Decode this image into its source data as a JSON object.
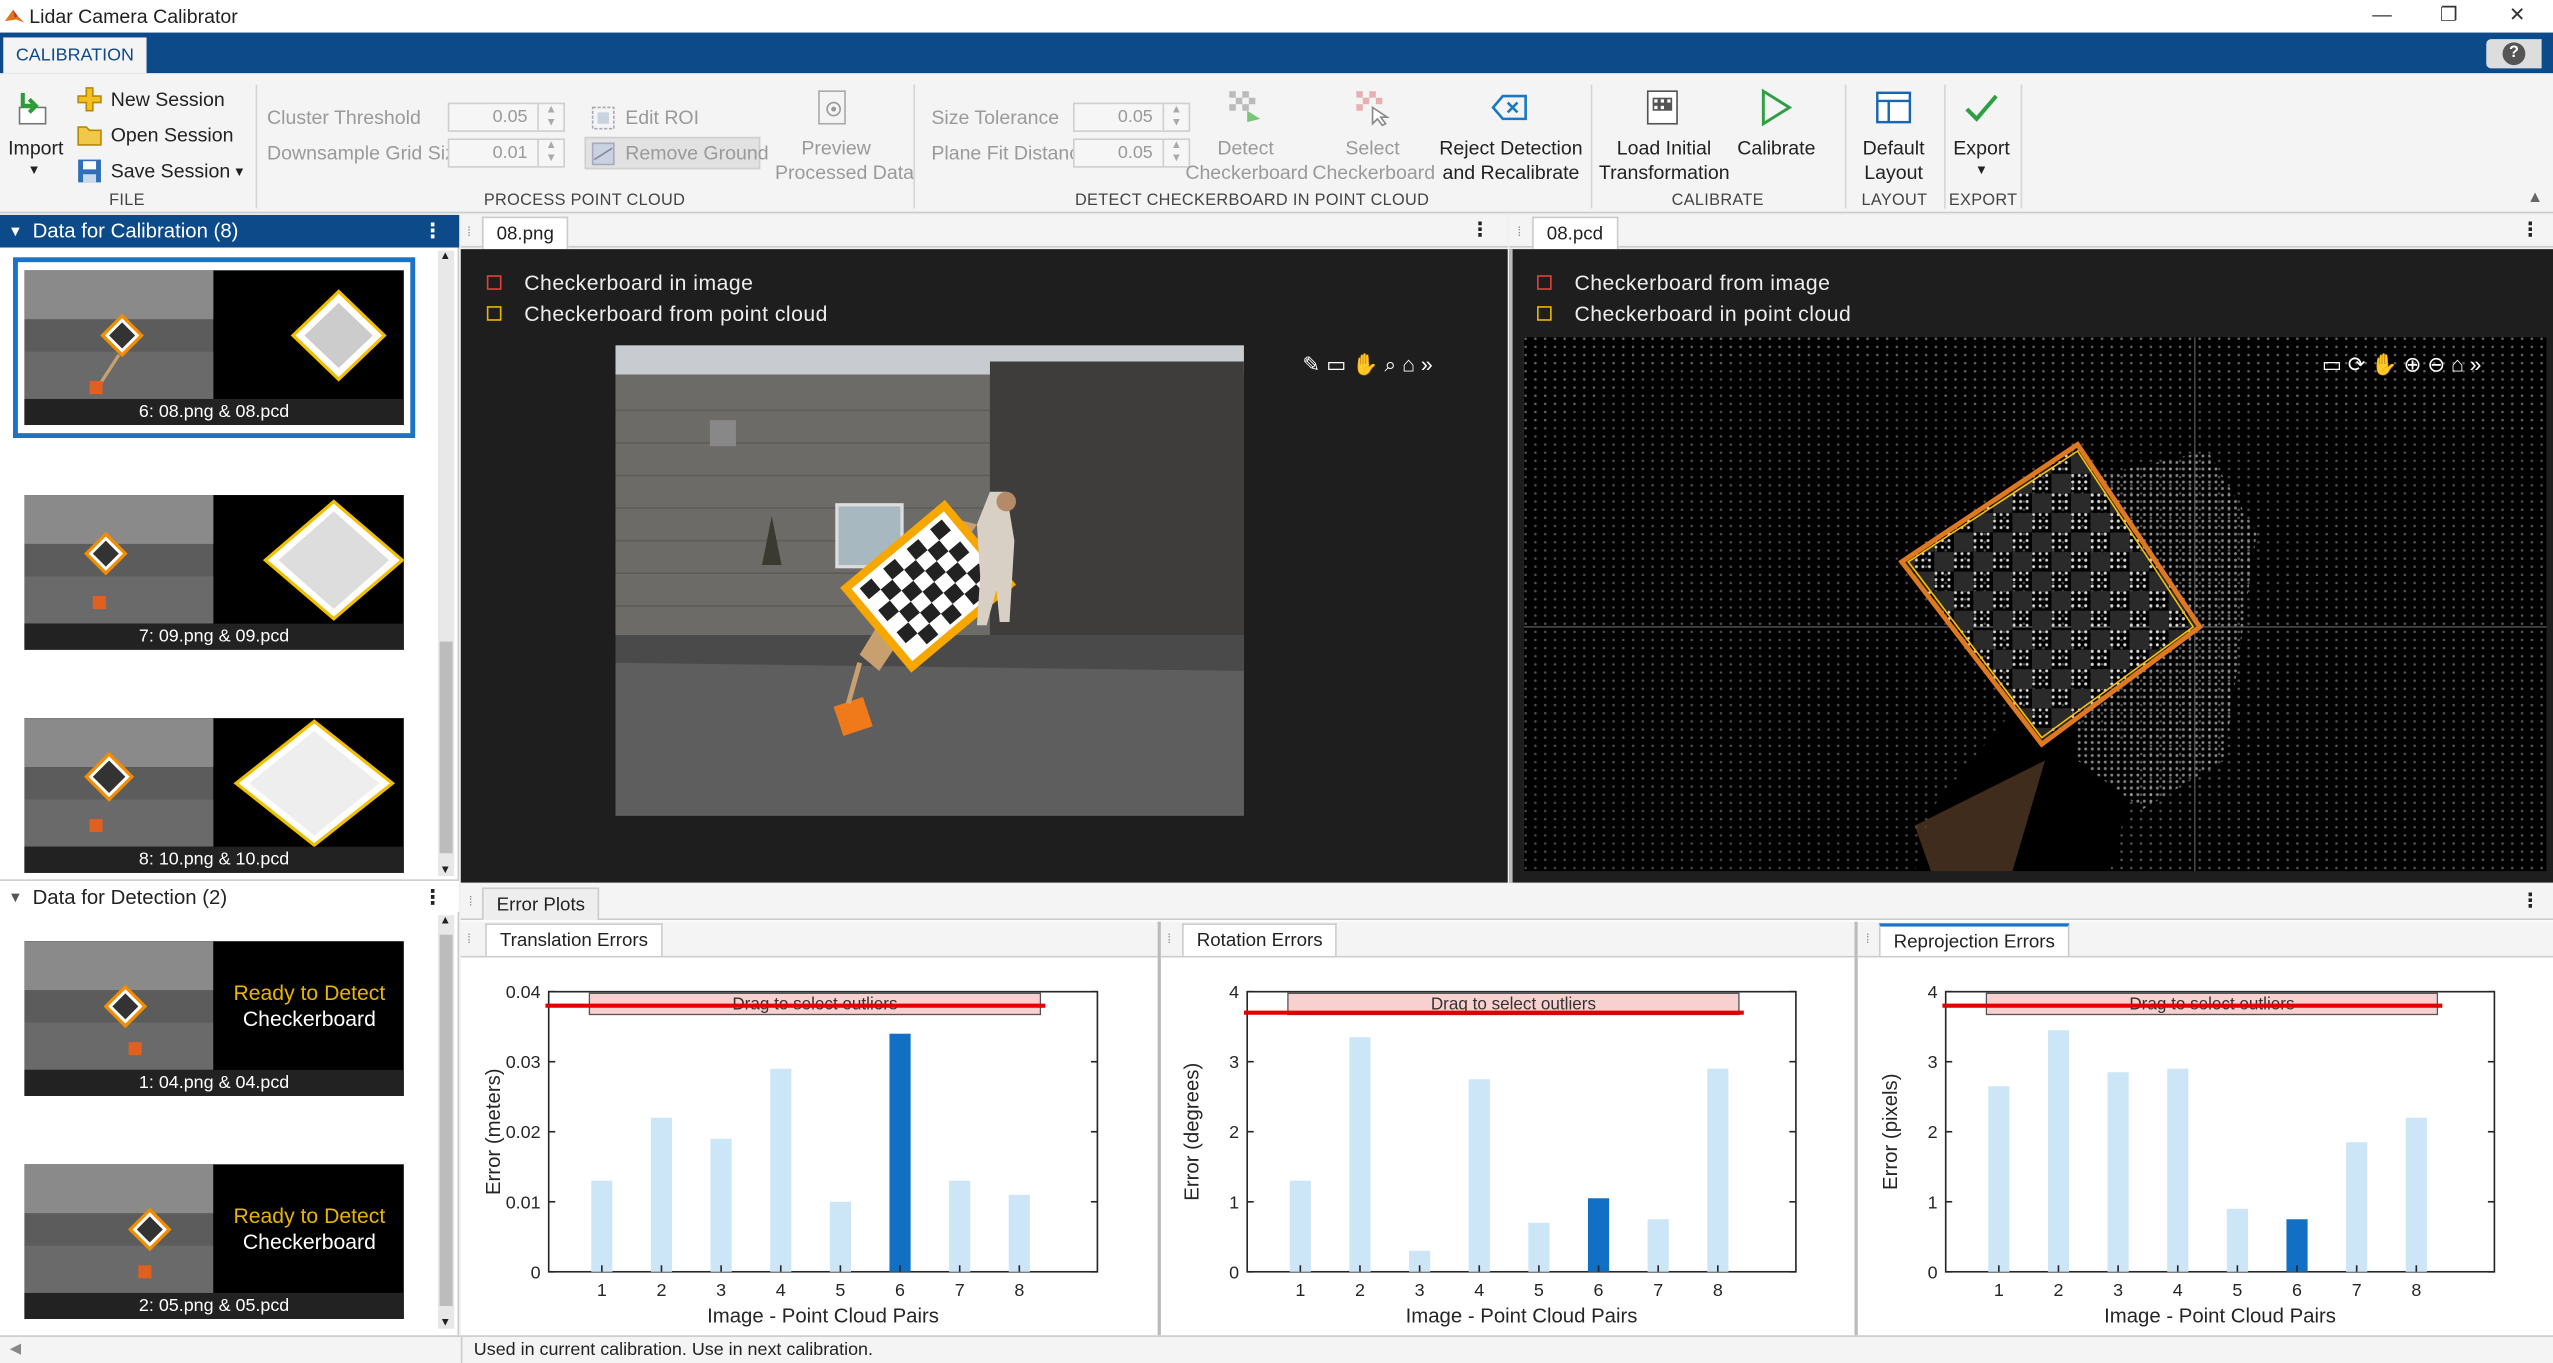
{
  "window": {
    "title": "Lidar Camera Calibrator",
    "minimize": "—",
    "restore": "❐",
    "close": "✕"
  },
  "tabs": [
    "CALIBRATION"
  ],
  "help_label": "?",
  "toolstrip": {
    "file": {
      "group_label": "FILE",
      "import_label": "Import",
      "new_session": "New Session",
      "open_session": "Open Session",
      "save_session": "Save Session"
    },
    "process": {
      "group_label": "PROCESS POINT CLOUD",
      "cluster_threshold_label": "Cluster Threshold",
      "cluster_threshold_value": "0.05",
      "downsample_label": "Downsample Grid Size",
      "downsample_value": "0.01",
      "edit_roi": "Edit ROI",
      "remove_ground": "Remove Ground",
      "preview_line1": "Preview",
      "preview_line2": "Processed Data"
    },
    "detect": {
      "group_label": "DETECT CHECKERBOARD IN POINT CLOUD",
      "size_tolerance_label": "Size Tolerance",
      "size_tolerance_value": "0.05",
      "plane_fit_label": "Plane Fit Distance",
      "plane_fit_value": "0.05",
      "detect_line1": "Detect",
      "detect_line2": "Checkerboard",
      "select_line1": "Select",
      "select_line2": "Checkerboard",
      "reject_line1": "Reject Detection",
      "reject_line2": "and Recalibrate"
    },
    "calibrate": {
      "group_label": "CALIBRATE",
      "load_line1": "Load Initial",
      "load_line2": "Transformation",
      "calibrate_label": "Calibrate"
    },
    "layout": {
      "group_label": "LAYOUT",
      "default_line1": "Default",
      "default_line2": "Layout"
    },
    "export": {
      "group_label": "EXPORT",
      "export_label": "Export"
    }
  },
  "left_panel": {
    "calibration_header": "Data for Calibration (8)",
    "calibration_items": [
      {
        "label": "6: 08.png & 08.pcd",
        "selected": true
      },
      {
        "label": "7: 09.png & 09.pcd",
        "selected": false
      },
      {
        "label": "8: 10.png & 10.pcd",
        "selected": false
      }
    ],
    "detection_header": "Data for Detection (2)",
    "detection_items": [
      {
        "label": "1: 04.png & 04.pcd",
        "status_line1": "Ready to Detect",
        "status_line2": "Checkerboard"
      },
      {
        "label": "2: 05.png & 05.pcd",
        "status_line1": "Ready to Detect",
        "status_line2": "Checkerboard"
      }
    ]
  },
  "image_pane": {
    "tab": "08.png",
    "legend": [
      "Checkerboard  in  image",
      "Checkerboard  from  point  cloud"
    ]
  },
  "pcd_pane": {
    "tab": "08.pcd",
    "legend": [
      "Checkerboard  from  image",
      "Checkerboard  in  point  cloud"
    ]
  },
  "colors": {
    "legend_red": "#e0403a",
    "legend_yellow": "#e8b400",
    "bar_light": "#cde6f7",
    "bar_selected": "#1170c4",
    "threshold_line": "#e00000",
    "drag_box": "#f9d0d0",
    "brand_blue": "#0c4a8a"
  },
  "error_panel": {
    "tab": "Error Plots",
    "subtabs": [
      "Translation Errors",
      "Rotation Errors",
      "Reprojection Errors"
    ]
  },
  "chart_data": [
    {
      "type": "bar",
      "title": "Translation Errors",
      "categories": [
        "1",
        "2",
        "3",
        "4",
        "5",
        "6",
        "7",
        "8"
      ],
      "values": [
        0.013,
        0.022,
        0.019,
        0.029,
        0.01,
        0.034,
        0.013,
        0.011
      ],
      "selected_index": 5,
      "threshold": 0.038,
      "ylim": [
        0,
        0.04
      ],
      "yticks": [
        "0",
        "0.01",
        "0.02",
        "0.03",
        "0.04"
      ],
      "xlabel": "Image - Point Cloud Pairs",
      "ylabel": "Error (meters)",
      "annotation": "Drag to select outliers"
    },
    {
      "type": "bar",
      "title": "Rotation Errors",
      "categories": [
        "1",
        "2",
        "3",
        "4",
        "5",
        "6",
        "7",
        "8"
      ],
      "values": [
        1.3,
        3.35,
        0.3,
        2.75,
        0.7,
        1.05,
        0.75,
        2.9
      ],
      "selected_index": 5,
      "threshold": 3.7,
      "ylim": [
        0,
        4
      ],
      "yticks": [
        "0",
        "1",
        "2",
        "3",
        "4"
      ],
      "xlabel": "Image - Point Cloud Pairs",
      "ylabel": "Error (degrees)",
      "annotation": "Drag to select outliers"
    },
    {
      "type": "bar",
      "title": "Reprojection Errors",
      "categories": [
        "1",
        "2",
        "3",
        "4",
        "5",
        "6",
        "7",
        "8"
      ],
      "values": [
        2.65,
        3.45,
        2.85,
        2.9,
        0.9,
        0.75,
        1.85,
        2.2
      ],
      "selected_index": 5,
      "threshold": 3.8,
      "ylim": [
        0,
        4
      ],
      "yticks": [
        "0",
        "1",
        "2",
        "3",
        "4"
      ],
      "xlabel": "Image - Point Cloud Pairs",
      "ylabel": "Error (pixels)",
      "annotation": "Drag to select outliers"
    }
  ],
  "status_bar": "Used in current calibration. Use in next calibration."
}
